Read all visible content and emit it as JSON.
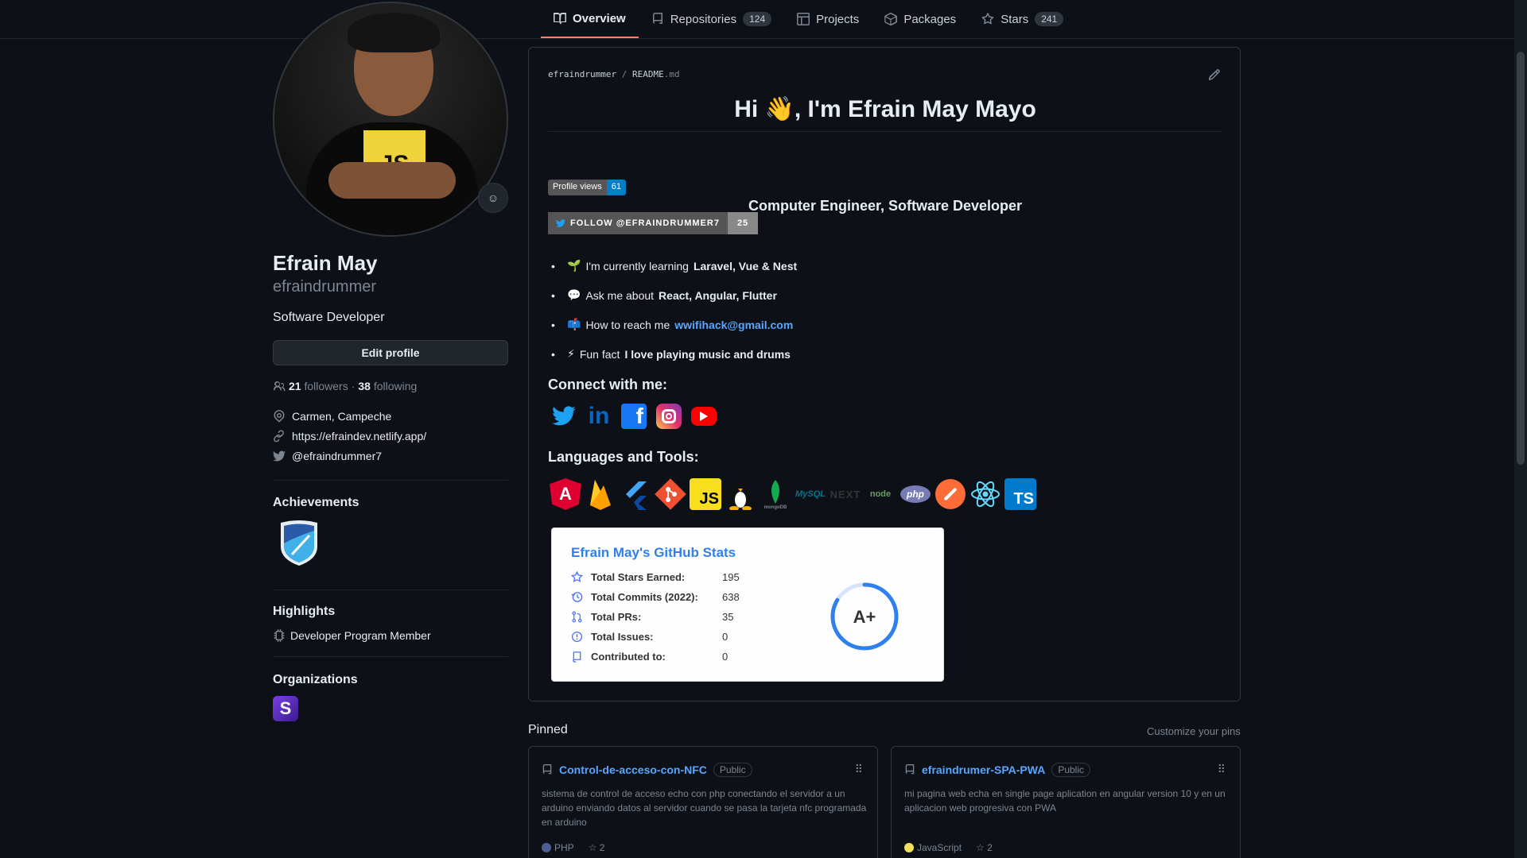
{
  "nav": {
    "tabs": [
      {
        "label": "Overview"
      },
      {
        "label": "Repositories",
        "count": "124"
      },
      {
        "label": "Projects"
      },
      {
        "label": "Packages"
      },
      {
        "label": "Stars",
        "count": "241"
      }
    ]
  },
  "profile": {
    "name": "Efrain May",
    "login": "efraindrummer",
    "bio": "Software Developer",
    "edit_label": "Edit profile",
    "followers": "21",
    "followers_label": "followers",
    "following": "38",
    "following_label": "following",
    "location": "Carmen, Campeche",
    "website": "https://efraindev.netlify.app/",
    "twitter": "@efraindrummer7",
    "achievements_title": "Achievements",
    "highlights_title": "Highlights",
    "highlight_item": "Developer Program Member",
    "organizations_title": "Organizations",
    "avatar_text": "JS"
  },
  "readme": {
    "owner": "efraindrummer",
    "sep": "/",
    "file": "README",
    "ext": ".md",
    "heading": "Hi 👋, I'm Efrain May Mayo",
    "subtitle": "Computer Engineer, Software Developer",
    "views_label": "Profile views",
    "views_count": "61",
    "twitter_badge_label": "FOLLOW @EFRAINDRUMMER7",
    "twitter_badge_count": "25",
    "facts": [
      {
        "emoji": "🌱",
        "prefix": "I'm currently learning",
        "bold": "Laravel, Vue & Nest"
      },
      {
        "emoji": "💬",
        "prefix": "Ask me about",
        "bold": "React, Angular, Flutter"
      },
      {
        "emoji": "📫",
        "prefix": "How to reach me",
        "link": "wwifihack@gmail.com"
      },
      {
        "emoji": "⚡",
        "prefix": "Fun fact",
        "bold": "I love playing music and drums"
      }
    ],
    "connect_title": "Connect with me:",
    "tools_title": "Languages and Tools:",
    "tools": [
      "Angular",
      "Firebase",
      "Flutter",
      "Git",
      "JS",
      "Linux",
      "mongoDB",
      "MySQL",
      "NEXT",
      "node",
      "php",
      "Postman",
      "React",
      "TS"
    ]
  },
  "stats": {
    "title": "Efrain May's GitHub Stats",
    "rows": [
      {
        "label": "Total Stars Earned:",
        "value": "195"
      },
      {
        "label": "Total Commits (2022):",
        "value": "638"
      },
      {
        "label": "Total PRs:",
        "value": "35"
      },
      {
        "label": "Total Issues:",
        "value": "0"
      },
      {
        "label": "Contributed to:",
        "value": "0"
      }
    ],
    "grade": "A+",
    "accent": "#2f80ed"
  },
  "pinned": {
    "title": "Pinned",
    "customize": "Customize your pins",
    "repos": [
      {
        "name": "Control-de-acceso-con-NFC",
        "visibility": "Public",
        "description": "sistema de control de acceso echo con php conectando el servidor a un arduino enviando datos al servidor cuando se pasa la tarjeta nfc programada en arduino",
        "language": "PHP",
        "language_color": "#4F5D95",
        "stars": "2"
      },
      {
        "name": "efraindrumer-SPA-PWA",
        "visibility": "Public",
        "description": "mi pagina web echa en single page aplication en angular version 10 y en un aplicacion web progresiva con PWA",
        "language": "JavaScript",
        "language_color": "#f1e05a",
        "stars": "2"
      }
    ]
  }
}
